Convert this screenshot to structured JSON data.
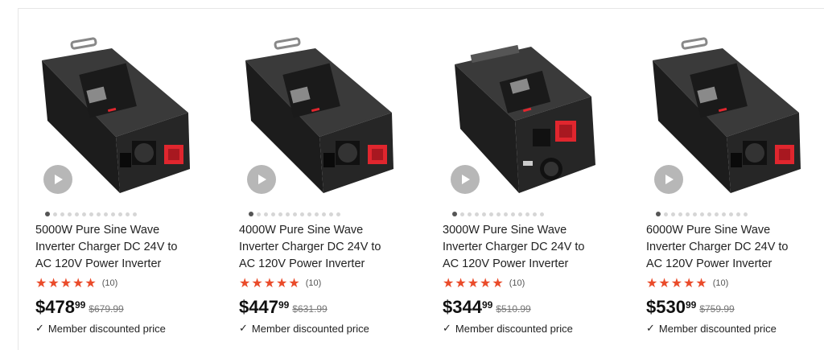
{
  "products": [
    {
      "title_lines": [
        "5000W Pure Sine Wave",
        "Inverter Charger DC 24V to",
        "AC 120V Power Inverter"
      ],
      "stars": 5,
      "review_count": "(10)",
      "currency": "$",
      "price_whole": "478",
      "price_cents": "99",
      "price_old": "$679.99",
      "member_text": "Member discounted price",
      "image_variant": "standard"
    },
    {
      "title_lines": [
        "4000W Pure Sine Wave",
        "Inverter Charger DC 24V to",
        "AC 120V Power Inverter"
      ],
      "stars": 5,
      "review_count": "(10)",
      "currency": "$",
      "price_whole": "447",
      "price_cents": "99",
      "price_old": "$631.99",
      "member_text": "Member discounted price",
      "image_variant": "standard"
    },
    {
      "title_lines": [
        "3000W Pure Sine Wave",
        "Inverter Charger DC 24V to",
        "AC 120V Power Inverter"
      ],
      "stars": 5,
      "review_count": "(10)",
      "currency": "$",
      "price_whole": "344",
      "price_cents": "99",
      "price_old": "$510.99",
      "member_text": "Member discounted price",
      "image_variant": "tall"
    },
    {
      "title_lines": [
        "6000W Pure Sine Wave",
        "Inverter Charger DC 24V to",
        "AC 120V Power Inverter"
      ],
      "stars": 5,
      "review_count": "(10)",
      "currency": "$",
      "price_whole": "530",
      "price_cents": "99",
      "price_old": "$759.99",
      "member_text": "Member discounted price",
      "image_variant": "standard"
    }
  ],
  "carousel": {
    "dot_count": 13,
    "active_index": 0
  },
  "colors": {
    "star": "#ea4b2a",
    "terminal_red": "#e0262e",
    "body": "#2b2b2b"
  },
  "icons": {
    "play": "play-icon",
    "check": "check-icon",
    "star": "star-icon"
  }
}
